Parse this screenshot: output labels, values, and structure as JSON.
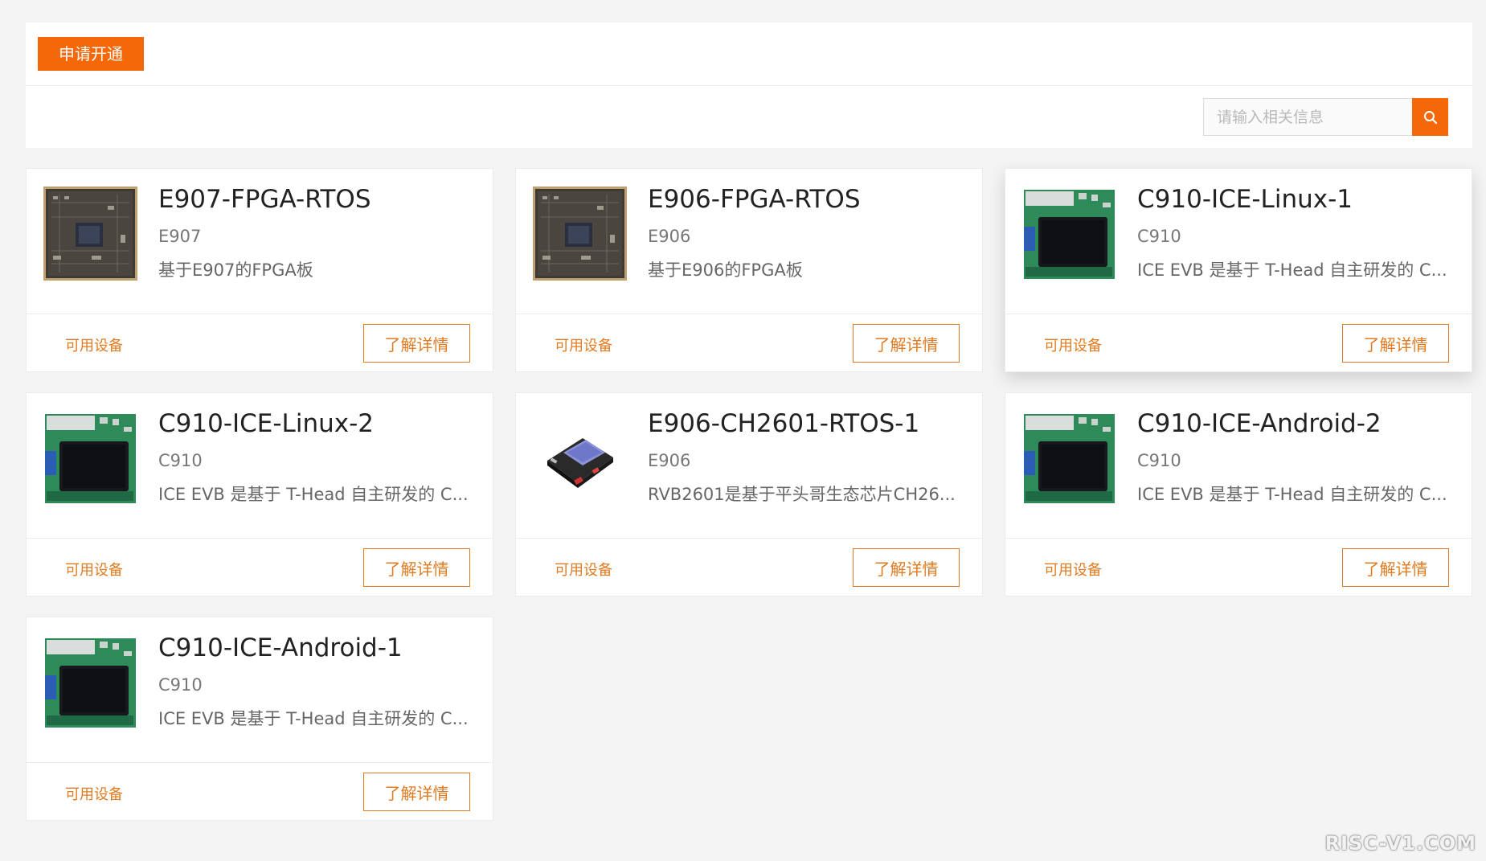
{
  "toolbar": {
    "apply_label": "申请开通"
  },
  "search": {
    "placeholder": "请输入相关信息",
    "value": ""
  },
  "colors": {
    "accent": "#f5680a",
    "link": "#e07b22",
    "background": "#f4f4f4"
  },
  "cards": [
    {
      "title": "E907-FPGA-RTOS",
      "chip": "E907",
      "desc": "基于E907的FPGA板",
      "image": "fpga-board-image",
      "available_label": "可用设备",
      "detail_label": "了解详情"
    },
    {
      "title": "E906-FPGA-RTOS",
      "chip": "E906",
      "desc": "基于E906的FPGA板",
      "image": "fpga-board-image",
      "available_label": "可用设备",
      "detail_label": "了解详情"
    },
    {
      "title": "C910-ICE-Linux-1",
      "chip": "C910",
      "desc": "ICE EVB 是基于 T-Head 自主研发的 C...",
      "image": "ice-evb-board-image",
      "available_label": "可用设备",
      "detail_label": "了解详情"
    },
    {
      "title": "C910-ICE-Linux-2",
      "chip": "C910",
      "desc": "ICE EVB 是基于 T-Head 自主研发的 C...",
      "image": "ice-evb-board-image",
      "available_label": "可用设备",
      "detail_label": "了解详情"
    },
    {
      "title": "E906-CH2601-RTOS-1",
      "chip": "E906",
      "desc": "RVB2601是基于平头哥生态芯片CH26...",
      "image": "rvb2601-board-image",
      "available_label": "可用设备",
      "detail_label": "了解详情"
    },
    {
      "title": "C910-ICE-Android-2",
      "chip": "C910",
      "desc": "ICE EVB 是基于 T-Head 自主研发的 C...",
      "image": "ice-evb-board-image",
      "available_label": "可用设备",
      "detail_label": "了解详情"
    },
    {
      "title": "C910-ICE-Android-1",
      "chip": "C910",
      "desc": "ICE EVB 是基于 T-Head 自主研发的 C...",
      "image": "ice-evb-board-image",
      "available_label": "可用设备",
      "detail_label": "了解详情"
    }
  ],
  "watermark": "RISC-V1.COM"
}
